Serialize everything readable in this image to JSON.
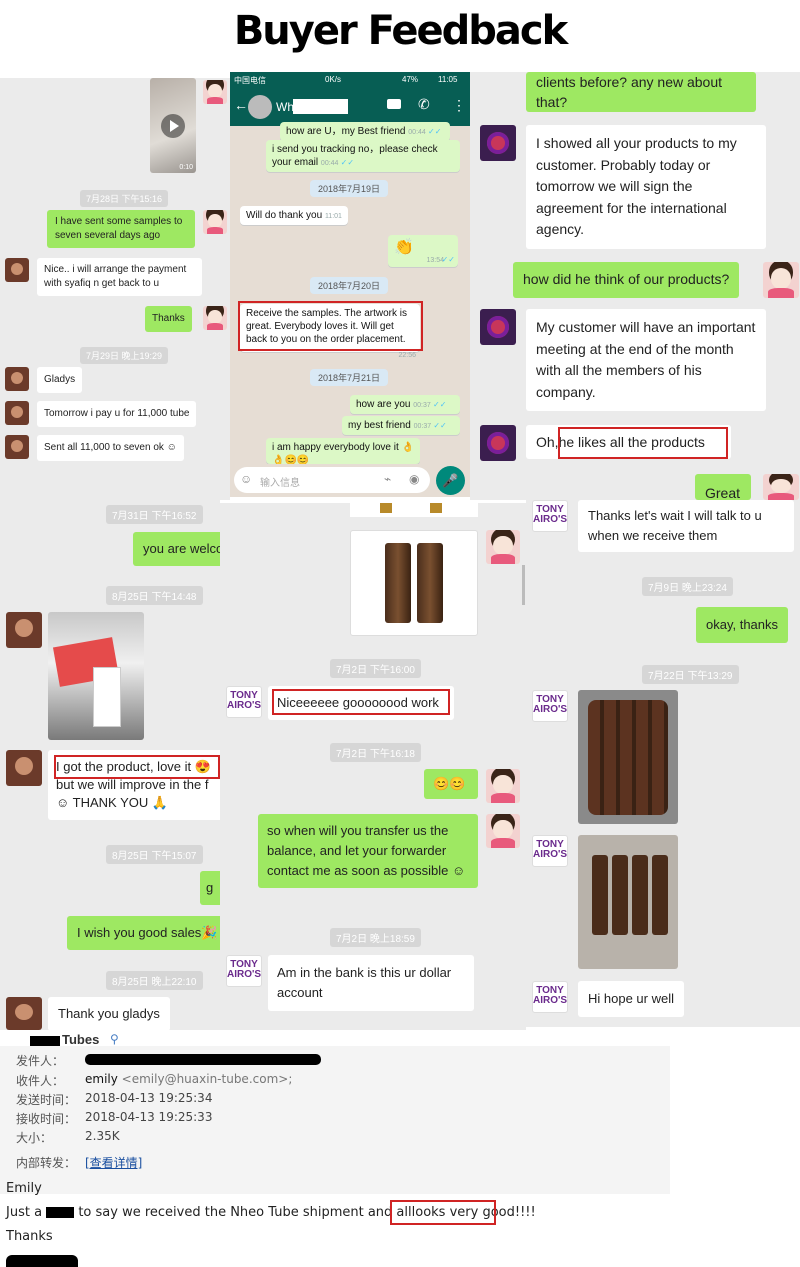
{
  "page_title": "Buyer Feedback",
  "left_chat": {
    "video_time": "0:10",
    "ts1": "7月28日 下午15:16",
    "sent_samples": "I have sent some samples to seven several days ago",
    "reply1": "Nice.. i will arrange the payment with syafiq n get back to u",
    "thanks": "Thanks",
    "ts2": "7月29日 晚上19:29",
    "gladys": "Gladys",
    "pay_msg": "Tomorrow i pay u for 11,000 tube",
    "sent_all": "Sent all 11,000 to seven ok ☺"
  },
  "whatsapp": {
    "status_carrier": "中国电信",
    "status_speed": "0K/s",
    "status_battery": "47%",
    "status_time": "11:05",
    "contact": "Wh",
    "msg_howareu": "how are U，my Best friend",
    "msg_howareu_time": "00:44",
    "msg_tracking": "i send you tracking no，please check your email",
    "msg_tracking_time": "00:44",
    "date1": "2018年7月19日",
    "msg_willdo": "Will do thank you",
    "msg_willdo_time": "11:01",
    "msg_clap": "👏",
    "msg_clap_time": "13:54",
    "date2": "2018年7月20日",
    "msg_samples": "Receive the samples. The artwork is great. Everybody loves it. Will get back to you on the order placement.",
    "msg_samples_time": "22:56",
    "date3": "2018年7月21日",
    "msg_howareyou": "how are you",
    "msg_howareyou_time": "00:37",
    "msg_bestfriend": "my best friend",
    "msg_bestfriend_time": "00:37",
    "msg_happy": "i am happy everybody love it 👌👌😊😊",
    "input_placeholder": "输入信息"
  },
  "right_top": {
    "msg_clients": "clients before? any new about that?",
    "msg_showed": "I showed all your products to my customer. Probably today or tomorrow we will sign the agreement for the international agency.",
    "msg_think": "how did he think of our products?",
    "msg_meeting": "My customer will have an important meeting at the end of the month with all the members of his company.",
    "msg_oh": "Oh,",
    "msg_likes": "he likes all the products",
    "msg_great": "Great"
  },
  "left_mid": {
    "ts1": "7月31日 下午16:52",
    "msg_welcome": "you are welco",
    "ts2": "8月25日 下午14:48",
    "msg_got": "I got the product, love it 😍",
    "msg_improve": "but we will improve in the f",
    "msg_thankyou": "☺ THANK YOU 🙏",
    "ts3": "8月25日 下午15:07",
    "msg_g": "g",
    "msg_sales": "I wish you good sales🎉",
    "ts4": "8月25日 晚上22:10",
    "msg_thankgladys": "Thank you gladys"
  },
  "center_chat": {
    "ts1": "7月2日 下午16:00",
    "msg_nice": "Niceeeeee goooooood work",
    "ts2": "7月2日 下午16:18",
    "msg_smile": "😊😊",
    "msg_transfer": "so when will you transfer us the balance, and let your forwarder contact me as soon as possible ☺",
    "ts3": "7月2日 晚上18:59",
    "msg_bank": "Am in the bank is this ur dollar account",
    "tony_logo": "TONY AIRO'S"
  },
  "right_bottom": {
    "msg_thanks_wait": "Thanks let's wait I will talk to u when we receive them",
    "ts1": "7月9日 晚上23:24",
    "msg_okay": "okay, thanks",
    "ts2": "7月22日 下午13:29",
    "msg_hope": "Hi hope ur well"
  },
  "email": {
    "subject_tail": "Tubes",
    "from_label": "发件人：",
    "to_label": "收件人：",
    "to_name": "emily",
    "to_addr": "<emily@huaxin-tube.com>;",
    "sent_label": "发送时间：",
    "sent_value": "2018-04-13 19:25:34",
    "recv_label": "接收时间：",
    "recv_value": "2018-04-13 19:25:33",
    "size_label": "大小：",
    "size_value": "2.35K",
    "forward_label": "内部转发：",
    "forward_link": "[查看详情]",
    "greeting": "Emily",
    "body_prefix": "Just a",
    "body_mid": "to say we received the Nheo Tube shipment and all",
    "body_highlight": "looks very good",
    "body_end": "!!!!",
    "sign": "Thanks"
  }
}
